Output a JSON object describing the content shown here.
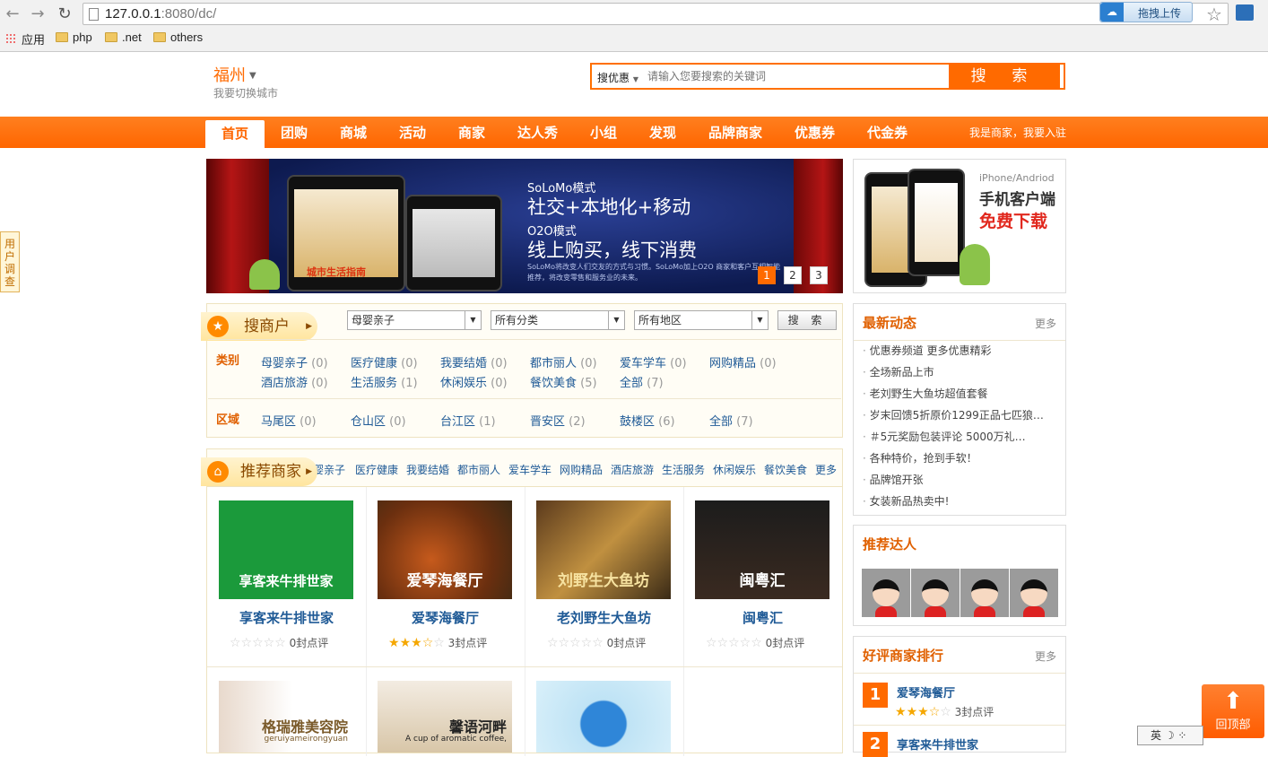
{
  "browser": {
    "url_host": "127.0.0.1",
    "url_port": ":8080/dc/",
    "extension_label": "拖拽上传",
    "bookmarks": [
      "应用",
      "php",
      ".net",
      "others"
    ]
  },
  "header": {
    "city": "福州",
    "city_switch": "我要切换城市",
    "search_category": "搜优惠",
    "search_placeholder": "请输入您要搜索的关键词",
    "search_button": "搜 索"
  },
  "nav": {
    "items": [
      "首页",
      "团购",
      "商城",
      "活动",
      "商家",
      "达人秀",
      "小组",
      "发现",
      "品牌商家",
      "优惠券",
      "代金券"
    ],
    "merchant_link": "我是商家，我要入驻"
  },
  "survey": "用户调查",
  "banner": {
    "line1": "SoLoMo模式",
    "line2": "社交+本地化+移动",
    "line3": "O2O模式",
    "line4": "线上购买，线下消费",
    "line5": "SoLoMo将改变人们交友的方式与习惯。SoLoMo加上O2O 商家和客户互相智能推荐，将改变零售和服务业的未来。",
    "logo_text": "城市生活指南",
    "pages": [
      "1",
      "2",
      "3"
    ]
  },
  "app_box": {
    "platform": "iPhone/Andriod",
    "title": "手机客户端",
    "cta": "免费下载"
  },
  "search_merchants": {
    "title": "搜商户",
    "select1": "母婴亲子",
    "select2": "所有分类",
    "select3": "所有地区",
    "button": "搜 索",
    "category_label": "类别",
    "categories": [
      {
        "name": "母婴亲子",
        "count": "(0)"
      },
      {
        "name": "医疗健康",
        "count": "(0)"
      },
      {
        "name": "我要结婚",
        "count": "(0)"
      },
      {
        "name": "都市丽人",
        "count": "(0)"
      },
      {
        "name": "爱车学车",
        "count": "(0)"
      },
      {
        "name": "网购精品",
        "count": "(0)"
      },
      {
        "name": "酒店旅游",
        "count": "(0)"
      },
      {
        "name": "生活服务",
        "count": "(1)"
      },
      {
        "name": "休闲娱乐",
        "count": "(0)"
      },
      {
        "name": "餐饮美食",
        "count": "(5)"
      },
      {
        "name": "全部",
        "count": "(7)"
      }
    ],
    "area_label": "区域",
    "areas": [
      {
        "name": "马尾区",
        "count": "(0)"
      },
      {
        "name": "仓山区",
        "count": "(0)"
      },
      {
        "name": "台江区",
        "count": "(1)"
      },
      {
        "name": "晋安区",
        "count": "(2)"
      },
      {
        "name": "鼓楼区",
        "count": "(6)"
      },
      {
        "name": "全部",
        "count": "(7)"
      }
    ]
  },
  "recommend": {
    "title": "推荐商家",
    "categories": [
      "婴亲子",
      "医疗健康",
      "我要结婚",
      "都市丽人",
      "爱车学车",
      "网购精品",
      "酒店旅游",
      "生活服务",
      "休闲娱乐",
      "餐饮美食",
      "更多"
    ],
    "cards": [
      {
        "name": "享客来牛排世家",
        "rating": 0,
        "reviews": "0封点评",
        "img_text": "享客来牛排世家"
      },
      {
        "name": "爱琴海餐厅",
        "rating": 3.5,
        "reviews": "3封点评",
        "img_text": "爱琴海餐厅"
      },
      {
        "name": "老刘野生大鱼坊",
        "rating": 0,
        "reviews": "0封点评",
        "img_text": "刘野生大鱼坊"
      },
      {
        "name": "闽粤汇",
        "rating": 0,
        "reviews": "0封点评",
        "img_text": "闽粤汇"
      }
    ],
    "cards_row2": [
      {
        "img_text": "格瑞雅美容院",
        "img_sub": "geruiyameirongyuan"
      },
      {
        "img_text": "馨语河畔",
        "img_sub": "A cup of aromatic coffee,"
      },
      {
        "img_text": ""
      }
    ]
  },
  "news": {
    "title": "最新动态",
    "more": "更多",
    "items": [
      "优惠券频道 更多优惠精彩",
      "全场新品上市",
      "老刘野生大鱼坊超值套餐",
      "岁末回馈5折原价1299正品七匹狼…",
      "＃5元奖励包装评论 5000万礼…",
      "各种特价，抢到手软！",
      "品牌馆开张",
      "女装新品热卖中!"
    ]
  },
  "experts": {
    "title": "推荐达人"
  },
  "ranking": {
    "title": "好评商家排行",
    "more": "更多",
    "items": [
      {
        "rank": "1",
        "name": "爱琴海餐厅",
        "rating": 3.5,
        "reviews": "3封点评"
      },
      {
        "rank": "2",
        "name": "享客来牛排世家"
      }
    ]
  },
  "back_top": "回顶部",
  "ime": "英 ☽ ⁘",
  "colors": {
    "accent": "#ff6a00",
    "link": "#1f5a96"
  }
}
